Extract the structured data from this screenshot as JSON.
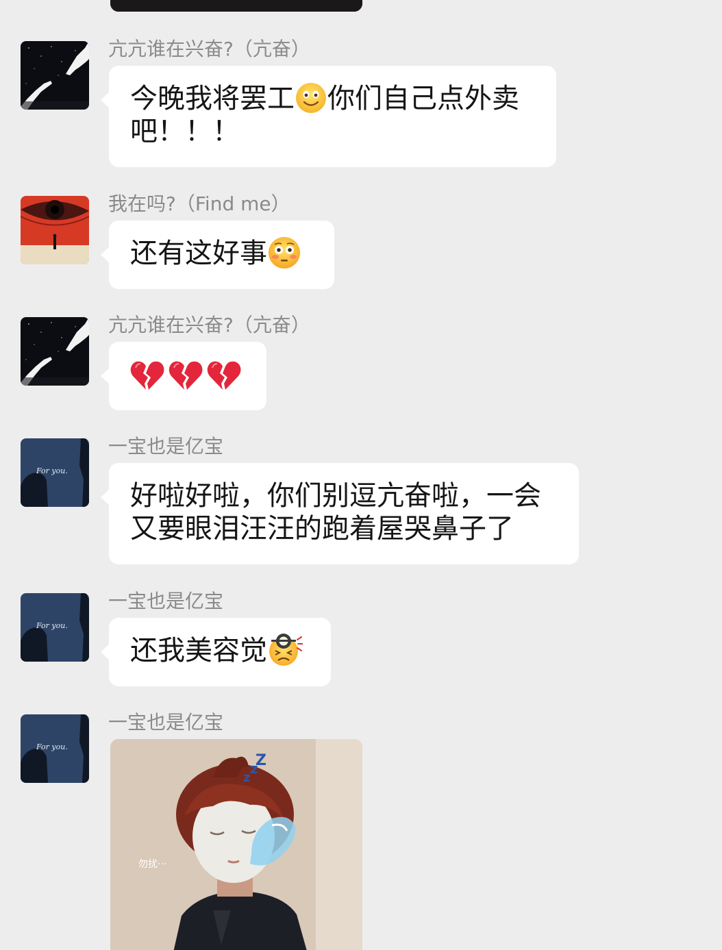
{
  "chat": {
    "messages": [
      {
        "sender": "亢亢谁在兴奋?（亢奋）",
        "avatar": "hands-reaching-avatar",
        "line1": "今晚我将罢工",
        "emoji1": "smiling-face-emoji",
        "line1b": "你们自己点外卖",
        "line2": "吧！！！"
      },
      {
        "sender": "我在吗?（Find me）",
        "avatar": "red-eye-avatar",
        "text": "还有这好事",
        "emoji": "flushed-face-emoji"
      },
      {
        "sender": "亢亢谁在兴奋?（亢奋）",
        "avatar": "hands-reaching-avatar",
        "emojis": [
          "broken-heart-emoji",
          "broken-heart-emoji",
          "broken-heart-emoji"
        ]
      },
      {
        "sender": "一宝也是亿宝",
        "avatar": "for-you-avatar",
        "line1": "好啦好啦，你们别逗亢奋啦，一会",
        "line2": "又要眼泪汪汪的跑着屋哭鼻子了"
      },
      {
        "sender": "一宝也是亿宝",
        "avatar": "for-you-avatar",
        "text": "还我美容觉",
        "emoji": "tired-face-emoji"
      },
      {
        "sender": "一宝也是亿宝",
        "avatar": "for-you-avatar",
        "image": "sleeping-face-mask-photo",
        "image_caption": "勿扰···"
      }
    ],
    "avatar_text": "For you."
  },
  "colors": {
    "background": "#ededed",
    "bubble": "#ffffff",
    "sender_name": "#8a8a8a",
    "text": "#151515"
  }
}
